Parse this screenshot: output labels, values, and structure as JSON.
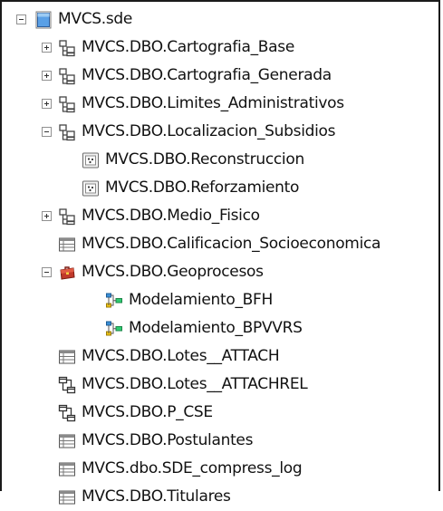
{
  "tree": {
    "root": {
      "label": "MVCS.sde",
      "icon": "database-icon",
      "expanded": true
    },
    "items": [
      {
        "label": "MVCS.DBO.Cartografia_Base",
        "icon": "feature-dataset-icon",
        "expanded": false
      },
      {
        "label": "MVCS.DBO.Cartografia_Generada",
        "icon": "feature-dataset-icon",
        "expanded": false
      },
      {
        "label": "MVCS.DBO.Limites_Administrativos",
        "icon": "feature-dataset-icon",
        "expanded": false
      },
      {
        "label": "MVCS.DBO.Localizacion_Subsidios",
        "icon": "feature-dataset-icon",
        "expanded": true
      },
      {
        "label": "MVCS.DBO.Reconstruccion",
        "icon": "point-feature-class-icon"
      },
      {
        "label": "MVCS.DBO.Reforzamiento",
        "icon": "point-feature-class-icon"
      },
      {
        "label": "MVCS.DBO.Medio_Fisico",
        "icon": "feature-dataset-icon",
        "expanded": false
      },
      {
        "label": "MVCS.DBO.Calificacion_Socioeconomica",
        "icon": "table-icon"
      },
      {
        "label": "MVCS.DBO.Geoprocesos",
        "icon": "toolbox-icon",
        "expanded": true
      },
      {
        "label": "Modelamiento_BFH",
        "icon": "model-tool-icon"
      },
      {
        "label": "Modelamiento_BPVVRS",
        "icon": "model-tool-icon"
      },
      {
        "label": "MVCS.DBO.Lotes__ATTACH",
        "icon": "table-icon"
      },
      {
        "label": "MVCS.DBO.Lotes__ATTACHREL",
        "icon": "relationship-class-icon"
      },
      {
        "label": "MVCS.DBO.P_CSE",
        "icon": "relationship-class-icon"
      },
      {
        "label": "MVCS.DBO.Postulantes",
        "icon": "table-icon"
      },
      {
        "label": "MVCS.dbo.SDE_compress_log",
        "icon": "table-icon"
      },
      {
        "label": "MVCS.DBO.Titulares",
        "icon": "table-icon"
      }
    ]
  }
}
